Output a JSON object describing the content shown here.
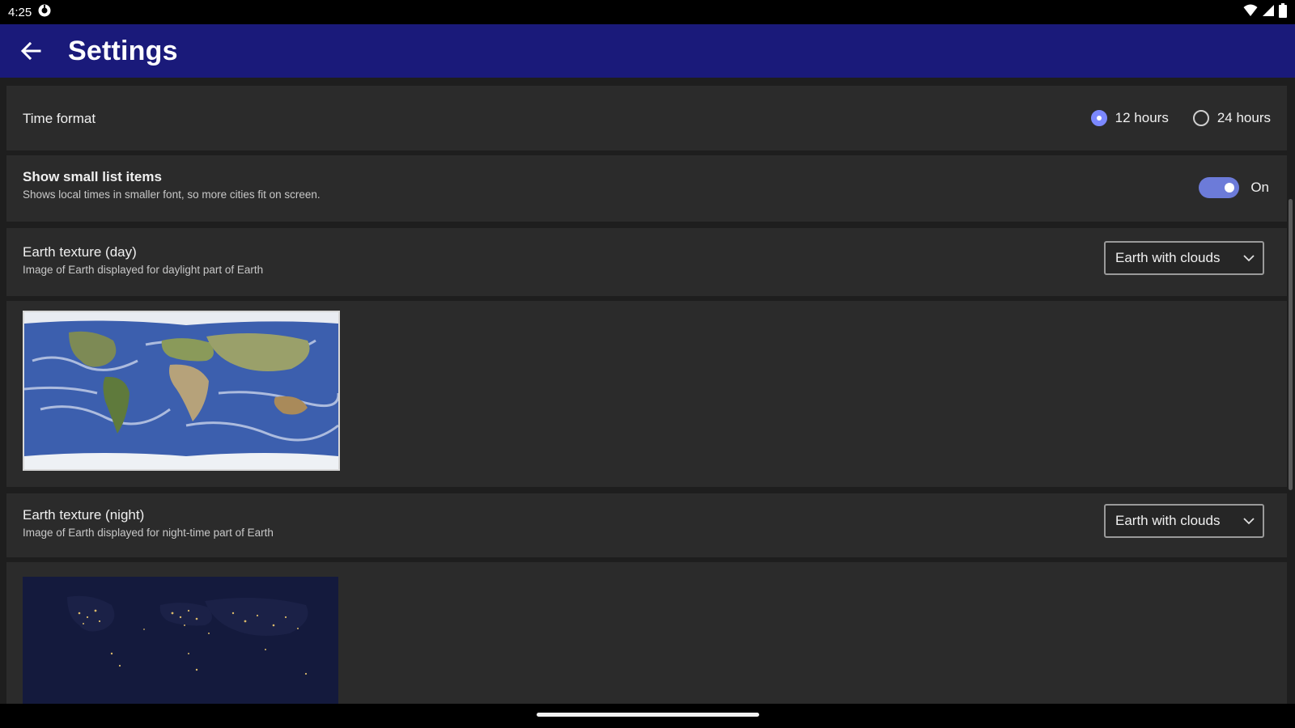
{
  "status_bar": {
    "time": "4:25",
    "icons": [
      "notification-icon",
      "wifi-icon",
      "signal-icon",
      "battery-icon"
    ]
  },
  "app_bar": {
    "title": "Settings",
    "back_icon": "arrow-back-icon",
    "background": "#1a1a7a"
  },
  "settings": {
    "time_format": {
      "label": "Time format",
      "options": [
        {
          "label": "12 hours",
          "selected": true
        },
        {
          "label": "24 hours",
          "selected": false
        }
      ]
    },
    "small_list_items": {
      "title": "Show small list items",
      "subtitle": "Shows local times in smaller font, so more cities fit on screen.",
      "toggle_state": "On",
      "enabled": true
    },
    "earth_day": {
      "title": "Earth texture (day)",
      "subtitle": "Image of Earth displayed for daylight part of Earth",
      "selected": "Earth with clouds"
    },
    "earth_night": {
      "title": "Earth texture (night)",
      "subtitle": "Image of Earth displayed for night-time part of Earth",
      "selected": "Earth with clouds"
    }
  },
  "colors": {
    "accent": "#7b88ff",
    "toggle_track": "#6c7bd9",
    "card": "#2b2b2b",
    "background": "#1e1e1e"
  }
}
